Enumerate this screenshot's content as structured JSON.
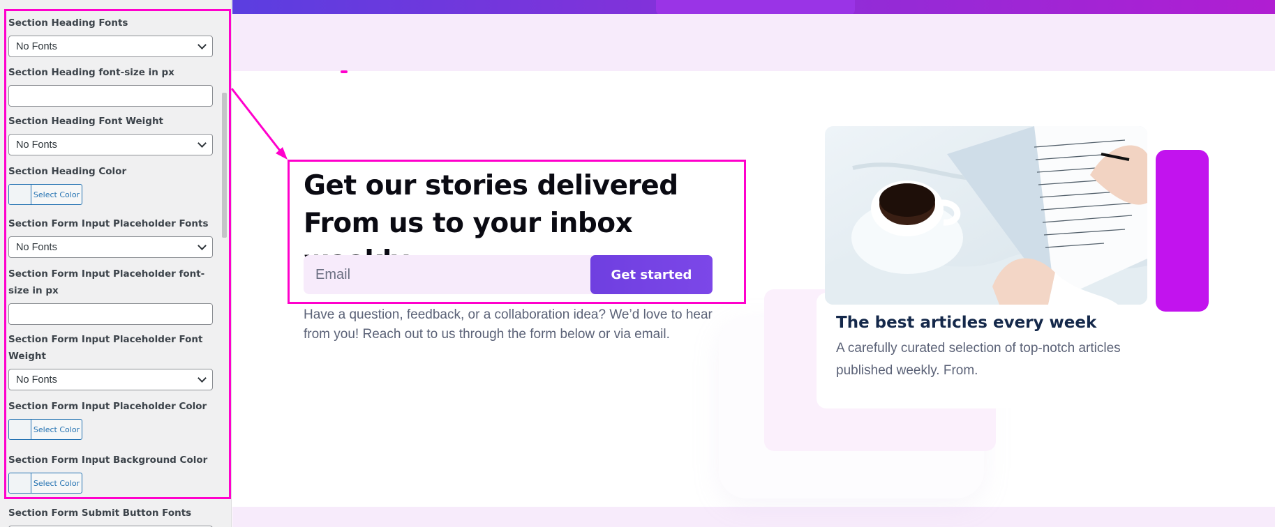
{
  "sidebar": {
    "fields": [
      {
        "label": "Section Heading Fonts",
        "type": "select",
        "value": "No Fonts"
      },
      {
        "label": "Section Heading font-size in px",
        "type": "text",
        "value": ""
      },
      {
        "label": "Section Heading Font Weight",
        "type": "select",
        "value": "No Fonts"
      },
      {
        "label": "Section Heading Color",
        "type": "color",
        "value": "Select Color"
      },
      {
        "label": "Section Form Input Placeholder Fonts",
        "type": "select",
        "value": "No Fonts"
      },
      {
        "label": "Section Form Input Placeholder font-size in px",
        "type": "text",
        "value": ""
      },
      {
        "label": "Section Form Input Placeholder Font Weight",
        "type": "select",
        "value": "No Fonts"
      },
      {
        "label": "Section Form Input Placeholder Color",
        "type": "color",
        "value": "Select Color"
      },
      {
        "label": "Section Form Input Background Color",
        "type": "color",
        "value": "Select Color"
      },
      {
        "label": "Section Form Submit Button Fonts",
        "type": "select",
        "value": ""
      }
    ]
  },
  "hero": {
    "title_line1": "Get our stories delivered",
    "title_line2": "From us to your inbox weekly.",
    "email_placeholder": "Email",
    "cta_label": "Get started",
    "description": "Have a question, feedback, or a collaboration idea? We’d love to hear from you! Reach out to us through the form below or via email."
  },
  "card": {
    "title": "The best articles every week",
    "description": "A carefully curated selection of top-notch articles published weekly. From."
  },
  "colors": {
    "highlight": "#ff00cc",
    "accent_purple": "#c213ee",
    "cta": "#6f3fe0",
    "lavender": "#f7ebfb"
  },
  "icons": {
    "select_arrow": "chevron-down-icon",
    "arrow": "pointer-arrow-icon"
  }
}
